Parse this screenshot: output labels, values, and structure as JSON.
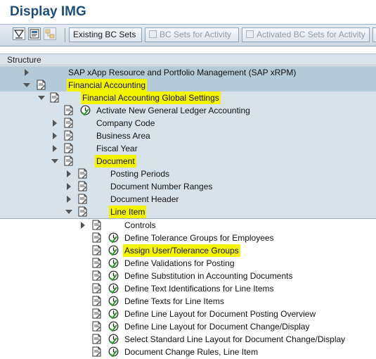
{
  "window": {
    "title": "Display IMG"
  },
  "toolbar": {
    "buttons": [
      {
        "label": "Existing BC Sets",
        "enabled": true
      },
      {
        "label": "BC Sets for Activity",
        "enabled": false
      },
      {
        "label": "Activated BC Sets for Activity",
        "enabled": false
      }
    ]
  },
  "tree": {
    "header": "Structure",
    "rows": [
      {
        "label": "SAP xApp Resource and Portfolio Management (SAP xRPM)"
      },
      {
        "label": "Financial Accounting"
      },
      {
        "label": "Financial Accounting Global Settings"
      },
      {
        "label": "Activate New General Ledger Accounting"
      },
      {
        "label": "Company Code"
      },
      {
        "label": "Business Area"
      },
      {
        "label": "Fiscal Year"
      },
      {
        "label": "Document"
      },
      {
        "label": "Posting Periods"
      },
      {
        "label": "Document Number Ranges"
      },
      {
        "label": "Document Header"
      },
      {
        "label": "Line Item"
      },
      {
        "label": "Controls"
      },
      {
        "label": "Define Tolerance Groups for Employees"
      },
      {
        "label": "Assign User/Tolerance Groups"
      },
      {
        "label": "Define Validations for Posting"
      },
      {
        "label": "Define Substitution in Accounting Documents"
      },
      {
        "label": "Define Text Identifications for Line Items"
      },
      {
        "label": "Define Texts for Line Items"
      },
      {
        "label": "Define Line Layout for Document Posting Overview"
      },
      {
        "label": "Define Line Layout for Document Change/Display"
      },
      {
        "label": "Select Standard Line Layout for Document Change/Display"
      },
      {
        "label": "Document Change Rules, Line Item"
      }
    ]
  },
  "colors": {
    "highlight": "#f4f400",
    "title": "#1f4e7a",
    "level1_bg": "#b3cbd8",
    "level2_bg": "#d7e2ea"
  }
}
